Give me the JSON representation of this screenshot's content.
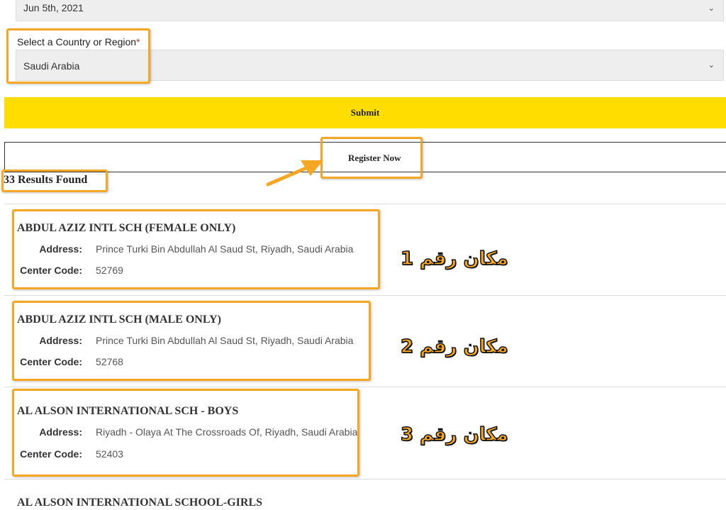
{
  "date_select": {
    "value": "Jun 5th, 2021"
  },
  "country_select": {
    "label": "Select a Country or Region",
    "required_mark": "*",
    "value": "Saudi Arabia"
  },
  "buttons": {
    "submit": "Submit",
    "register": "Register Now"
  },
  "results": {
    "count_text": "33 Results Found"
  },
  "annotations": [
    "مكان رقم 1",
    "مكان رقم 2",
    "مكان رقم 3"
  ],
  "centers": [
    {
      "name": "ABDUL AZIZ INTL SCH (FEMALE ONLY)",
      "address_label": "Address:",
      "address": "Prince Turki Bin Abdullah Al Saud St, Riyadh, Saudi Arabia",
      "code_label": "Center Code:",
      "code": "52769"
    },
    {
      "name": "ABDUL AZIZ INTL SCH (MALE ONLY)",
      "address_label": "Address:",
      "address": "Prince Turki Bin Abdullah Al Saud St, Riyadh, Saudi Arabia",
      "code_label": "Center Code:",
      "code": "52768"
    },
    {
      "name": "AL ALSON INTERNATIONAL SCH - BOYS",
      "address_label": "Address:",
      "address": "Riyadh - Olaya At The Crossroads Of, Riyadh, Saudi Arabia",
      "code_label": "Center Code:",
      "code": "52403"
    },
    {
      "name": "AL ALSON INTERNATIONAL SCHOOL-GIRLS"
    }
  ],
  "colors": {
    "accent": "#ffdd00",
    "highlight": "#f5a623"
  }
}
